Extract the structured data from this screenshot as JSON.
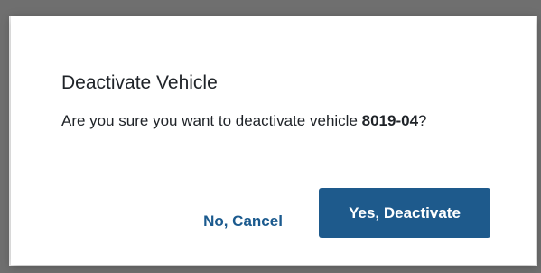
{
  "dialog": {
    "title": "Deactivate Vehicle",
    "message_prefix": "Are you sure you want to deactivate vehicle ",
    "vehicle_id": "8019-04",
    "message_suffix": "?",
    "cancel_label": "No, Cancel",
    "confirm_label": "Yes, Deactivate"
  },
  "colors": {
    "primary": "#1e5a8c",
    "link": "#1b5a8e",
    "backdrop": "#6f6f6f"
  }
}
